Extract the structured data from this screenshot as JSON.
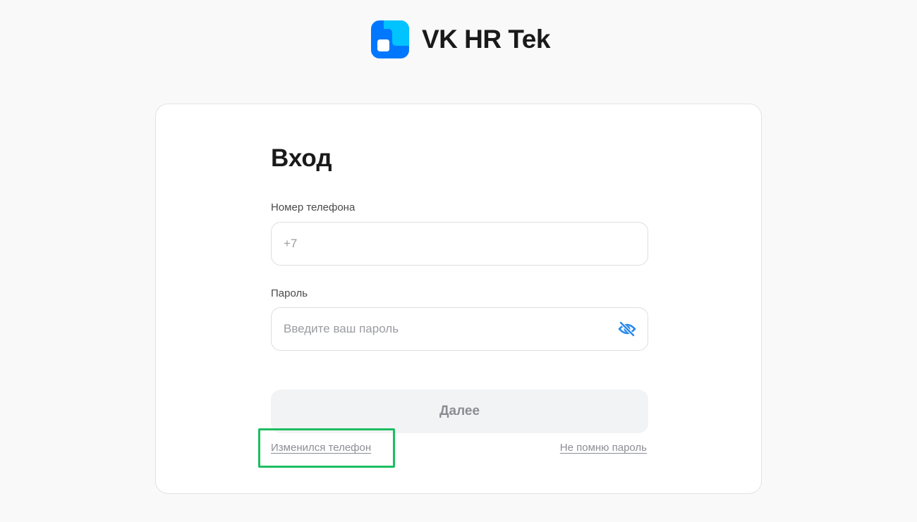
{
  "brand": {
    "name": "VK HR Tek",
    "logo_icon": "vk-hr-tek-logo-icon",
    "colors": {
      "logo_primary": "#0077ff",
      "logo_secondary": "#00c3ff"
    }
  },
  "login": {
    "title": "Вход",
    "phone": {
      "label": "Номер телефона",
      "value": "",
      "placeholder": "+7"
    },
    "password": {
      "label": "Пароль",
      "value": "",
      "placeholder": "Введите ваш пароль",
      "toggle_icon": "eye-slash-icon",
      "toggle_color": "#2688eb"
    },
    "submit_label": "Далее",
    "links": {
      "phone_changed": "Изменился телефон",
      "forgot_password": "Не помню пароль"
    },
    "highlight_color": "#1dbe62"
  }
}
